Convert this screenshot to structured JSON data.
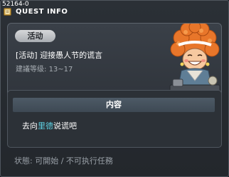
{
  "window": {
    "id": "52164-0",
    "title": "QUEST INFO"
  },
  "quest": {
    "badge": "活动",
    "title": "[活动] 迎接愚人节的谎言",
    "level_label": "建議等级:",
    "level_range": "13~17"
  },
  "content": {
    "header": "内容",
    "text_before": "去向",
    "npc_name": "里德",
    "text_after": "说谎吧"
  },
  "status": {
    "text": "状態: 可開始 / 不可执行任務"
  },
  "colors": {
    "npc_name": "#5fd4e6",
    "npc_hair": "#e8762a"
  }
}
